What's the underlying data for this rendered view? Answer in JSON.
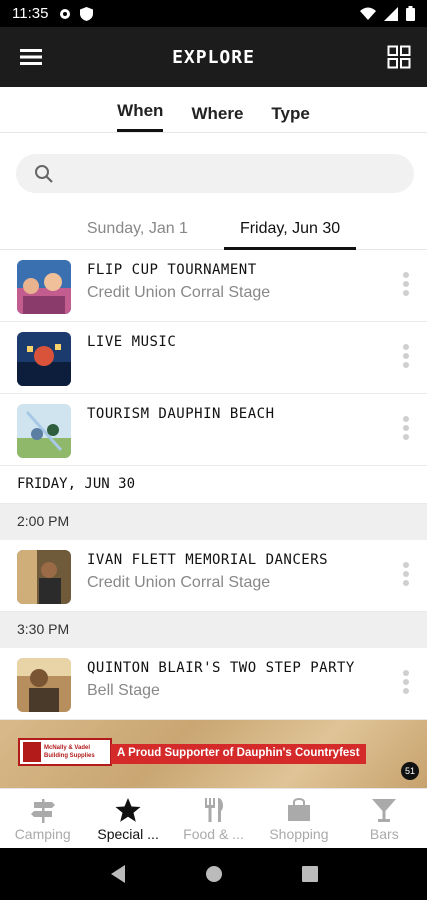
{
  "status_bar": {
    "time": "11:35"
  },
  "app_bar": {
    "title": "EXPLORE"
  },
  "filter_tabs": [
    {
      "label": "When",
      "active": true
    },
    {
      "label": "Where",
      "active": false
    },
    {
      "label": "Type",
      "active": false
    }
  ],
  "search": {
    "placeholder": ""
  },
  "date_tabs": [
    {
      "label": "Sunday, Jan 1",
      "active": false
    },
    {
      "label": "Friday, Jun 30",
      "active": true
    }
  ],
  "events_top": [
    {
      "title": "FLIP CUP TOURNAMENT",
      "location": "Credit Union Corral Stage"
    },
    {
      "title": "LIVE MUSIC",
      "location": ""
    },
    {
      "title": "TOURISM DAUPHIN BEACH",
      "location": ""
    }
  ],
  "day_header": "FRIDAY, JUN 30",
  "time_groups": [
    {
      "time": "2:00 PM",
      "title": "IVAN FLETT MEMORIAL DANCERS",
      "location": "Credit Union Corral Stage"
    },
    {
      "time": "3:30 PM",
      "title": "QUINTON BLAIR'S TWO STEP PARTY",
      "location": "Bell Stage"
    }
  ],
  "banner": {
    "logo_text": "McNally & Vadel Building Supplies",
    "slogan": "A Proud Supporter of Dauphin's Countryfest",
    "badge": "51"
  },
  "bottom_nav": [
    {
      "label": "Camping",
      "icon": "signpost-icon",
      "active": false
    },
    {
      "label": "Special ...",
      "icon": "star-icon",
      "active": true
    },
    {
      "label": "Food & ...",
      "icon": "cutlery-icon",
      "active": false
    },
    {
      "label": "Shopping",
      "icon": "shopping-bag-icon",
      "active": false
    },
    {
      "label": "Bars",
      "icon": "cocktail-icon",
      "active": false
    }
  ],
  "colors": {
    "app_bar": "#1c1c1c",
    "banner_red": "#d42a2a",
    "inactive": "#aaaaaa"
  }
}
